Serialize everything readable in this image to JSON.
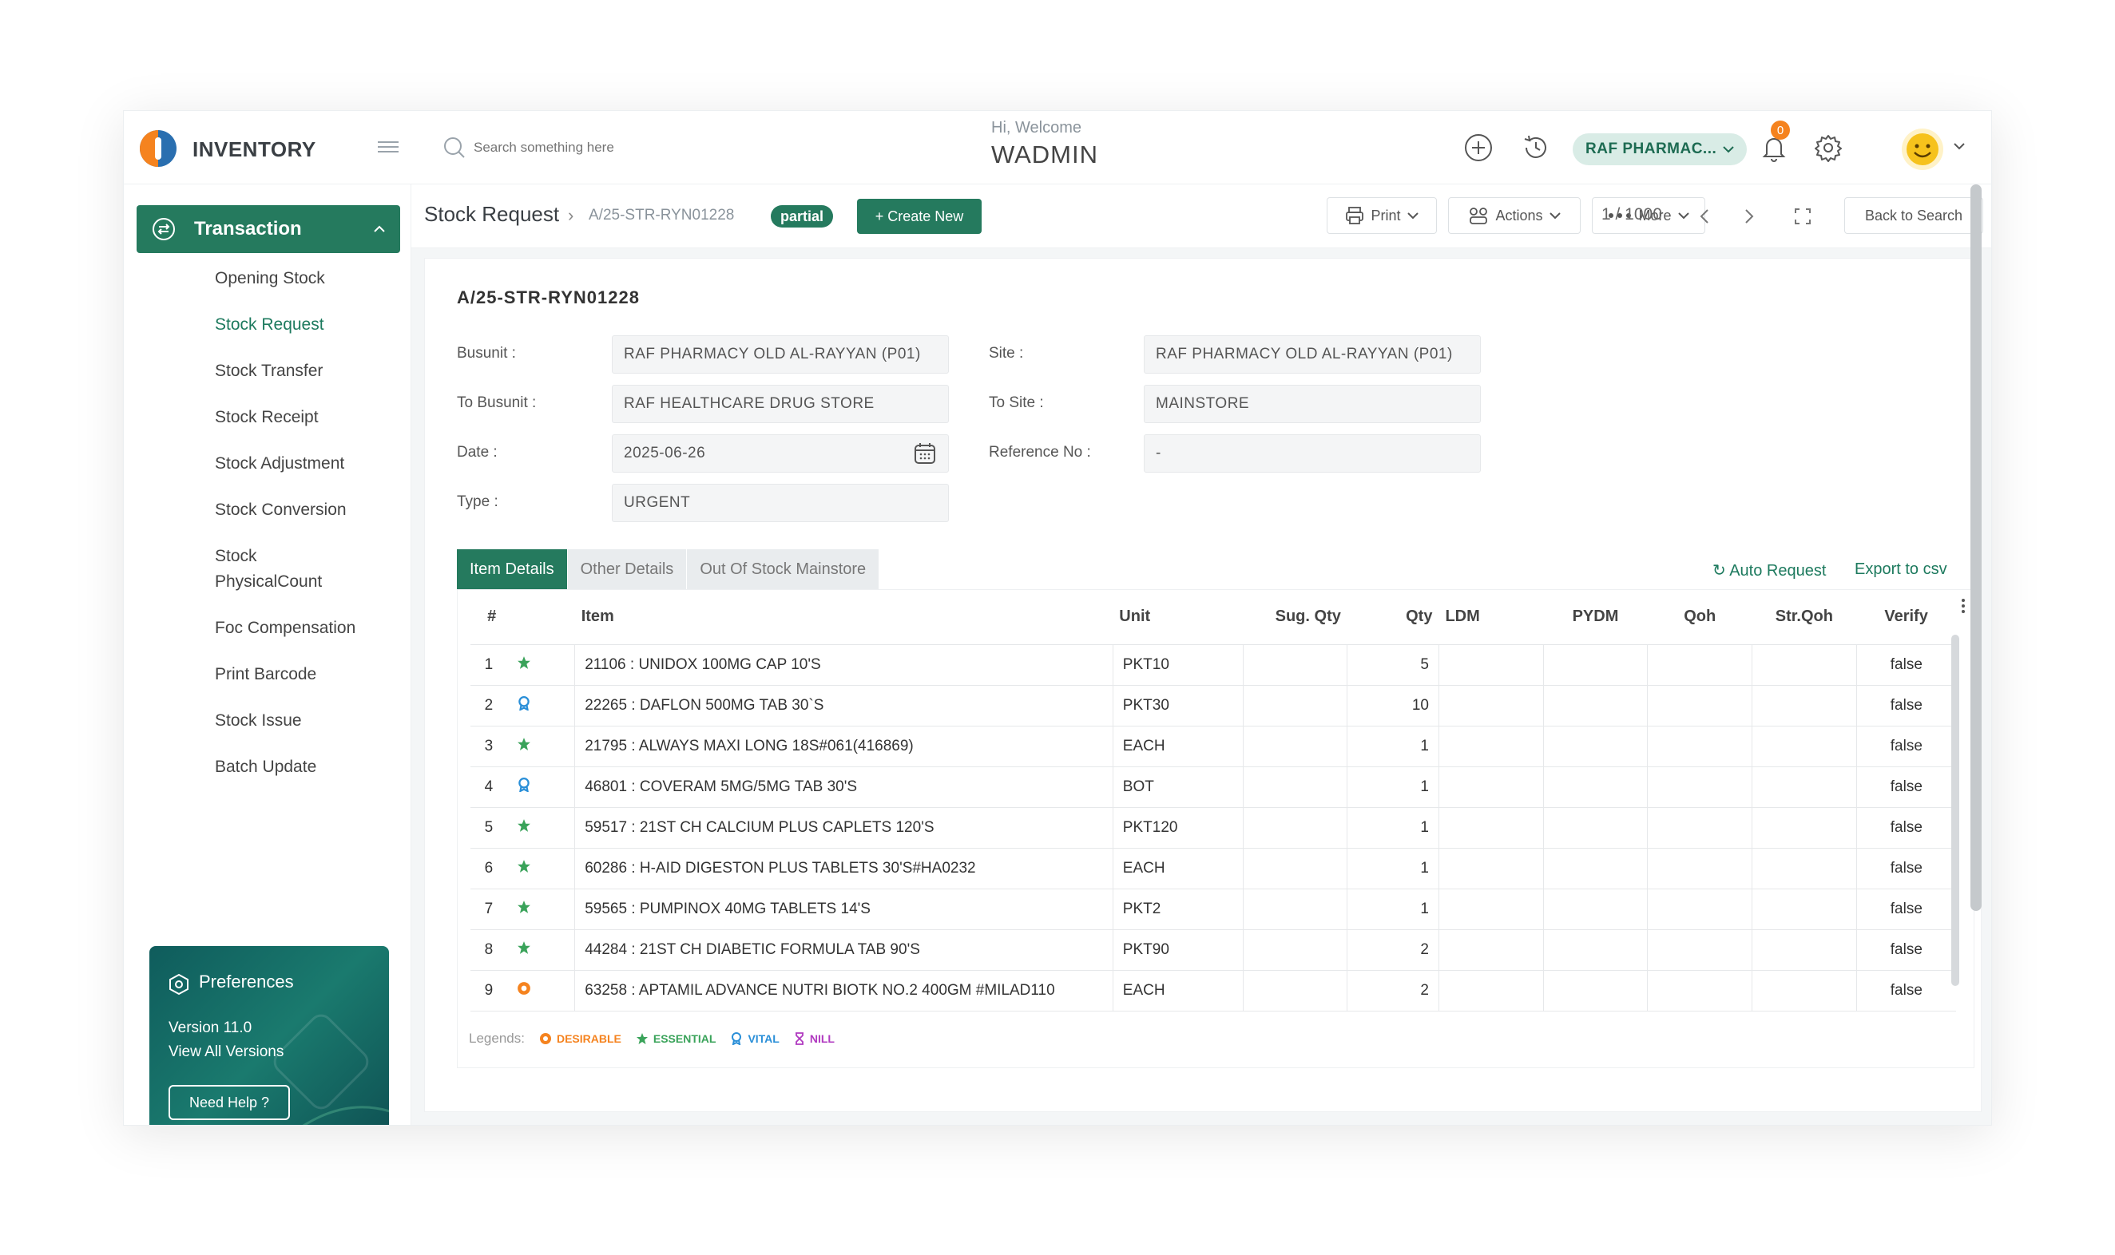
{
  "app": {
    "brand": "INVENTORY",
    "search_placeholder": "Search something here",
    "welcome": "Hi, Welcome",
    "user": "WADMIN",
    "site": "RAF PHARMAC...",
    "notification_count": "0"
  },
  "sidebar": {
    "section": "Transaction",
    "items": [
      {
        "label": "Opening Stock"
      },
      {
        "label": "Stock Request"
      },
      {
        "label": "Stock Transfer"
      },
      {
        "label": "Stock Receipt"
      },
      {
        "label": "Stock Adjustment"
      },
      {
        "label": "Stock Conversion"
      },
      {
        "label": "Stock"
      },
      {
        "label": "PhysicalCount"
      },
      {
        "label": "Foc Compensation"
      },
      {
        "label": "Print Barcode"
      },
      {
        "label": "Stock Issue"
      },
      {
        "label": "Batch Update"
      }
    ],
    "preferences": {
      "title": "Preferences",
      "version": "Version 11.0",
      "view_all": "View All Versions",
      "help": "Need Help ?"
    }
  },
  "toolbar": {
    "breadcrumb": "Stock Request",
    "sep": "›",
    "doc_no": "A/25-STR-RYN01228",
    "status": "partial",
    "create": "+ Create New",
    "print": "Print",
    "actions": "Actions",
    "more": "More",
    "pager": "1 / 1000",
    "back": "Back to Search"
  },
  "form": {
    "title": "A/25-STR-RYN01228",
    "busunit_label": "Busunit  :",
    "busunit": "RAF PHARMACY OLD AL-RAYYAN (P01)",
    "site_label": "Site  :",
    "site": "RAF PHARMACY OLD AL-RAYYAN (P01)",
    "to_busunit_label": "To Busunit  :",
    "to_busunit": "RAF HEALTHCARE DRUG STORE",
    "to_site_label": "To Site  :",
    "to_site": "MAINSTORE",
    "date_label": "Date  :",
    "date": "2025-06-26",
    "ref_label": "Reference No  :",
    "ref": "-",
    "type_label": "Type  :",
    "type": "URGENT"
  },
  "tabs": [
    "Item Details",
    "Other Details",
    "Out Of Stock Mainstore"
  ],
  "links": {
    "auto_request": "↻ Auto Request",
    "export": "Export to csv"
  },
  "table": {
    "columns": [
      "#",
      "Item",
      "Unit",
      "Sug. Qty",
      "Qty",
      "LDM",
      "PYDM",
      "Qoh",
      "Str.Qoh",
      "Verify"
    ],
    "rows": [
      {
        "n": "1",
        "cls": "essential",
        "item": "21106 : UNIDOX 100MG CAP 10'S",
        "unit": "PKT10",
        "sug": "",
        "qty": "5",
        "ldm": "",
        "pydm": "",
        "qoh": "",
        "strqoh": "",
        "verify": "false"
      },
      {
        "n": "2",
        "cls": "vital",
        "item": "22265 : DAFLON 500MG TAB 30`S",
        "unit": "PKT30",
        "sug": "",
        "qty": "10",
        "ldm": "",
        "pydm": "",
        "qoh": "",
        "strqoh": "",
        "verify": "false"
      },
      {
        "n": "3",
        "cls": "essential",
        "item": "21795 : ALWAYS MAXI LONG 18S#061(416869)",
        "unit": "EACH",
        "sug": "",
        "qty": "1",
        "ldm": "",
        "pydm": "",
        "qoh": "",
        "strqoh": "",
        "verify": "false"
      },
      {
        "n": "4",
        "cls": "vital",
        "item": "46801 : COVERAM 5MG/5MG TAB 30'S",
        "unit": "BOT",
        "sug": "",
        "qty": "1",
        "ldm": "",
        "pydm": "",
        "qoh": "",
        "strqoh": "",
        "verify": "false"
      },
      {
        "n": "5",
        "cls": "essential",
        "item": "59517 : 21ST CH CALCIUM PLUS CAPLETS 120'S",
        "unit": "PKT120",
        "sug": "",
        "qty": "1",
        "ldm": "",
        "pydm": "",
        "qoh": "",
        "strqoh": "",
        "verify": "false"
      },
      {
        "n": "6",
        "cls": "essential",
        "item": "60286 : H-AID DIGESTON PLUS TABLETS 30'S#HA0232",
        "unit": "EACH",
        "sug": "",
        "qty": "1",
        "ldm": "",
        "pydm": "",
        "qoh": "",
        "strqoh": "",
        "verify": "false"
      },
      {
        "n": "7",
        "cls": "essential",
        "item": "59565 : PUMPINOX 40MG TABLETS 14'S",
        "unit": "PKT2",
        "sug": "",
        "qty": "1",
        "ldm": "",
        "pydm": "",
        "qoh": "",
        "strqoh": "",
        "verify": "false"
      },
      {
        "n": "8",
        "cls": "essential",
        "item": "44284 : 21ST CH DIABETIC FORMULA TAB 90'S",
        "unit": "PKT90",
        "sug": "",
        "qty": "2",
        "ldm": "",
        "pydm": "",
        "qoh": "",
        "strqoh": "",
        "verify": "false"
      },
      {
        "n": "9",
        "cls": "desirable",
        "item": "63258 : APTAMIL ADVANCE NUTRI BIOTK NO.2 400GM #MILAD110",
        "unit": "EACH",
        "sug": "",
        "qty": "2",
        "ldm": "",
        "pydm": "",
        "qoh": "",
        "strqoh": "",
        "verify": "false"
      }
    ]
  },
  "legend": {
    "label": "Legends:",
    "items": [
      {
        "label": "DESIRABLE",
        "color": "#f5831f"
      },
      {
        "label": "ESSENTIAL",
        "color": "#3aa35a"
      },
      {
        "label": "VITAL",
        "color": "#2a8fd8"
      },
      {
        "label": "NILL",
        "color": "#b03ac0"
      }
    ]
  },
  "colors": {
    "accent": "#257a5e",
    "desirable": "#f5831f",
    "essential": "#3aa35a",
    "vital": "#2a8fd8",
    "nill": "#b03ac0"
  }
}
